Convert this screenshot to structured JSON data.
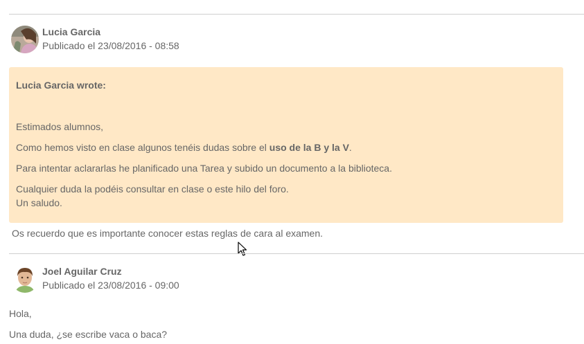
{
  "post1": {
    "author": "Lucia Garcia",
    "date": "Publicado el 23/08/2016 - 08:58",
    "quote": {
      "title": "Lucia Garcia wrote:",
      "greeting": "Estimados alumnos,",
      "line1_pre": "Como hemos visto en clase algunos tenéis dudas sobre el ",
      "line1_bold": "uso de la B y la V",
      "line1_post": ".",
      "line2": "Para intentar aclararlas he planificado una Tarea y subido un documento a la biblioteca.",
      "line3": "Cualquier duda la podéis consultar en clase o este hilo del foro.",
      "line4": "Un saludo."
    },
    "body": "Os recuerdo que es importante conocer estas reglas de cara al examen."
  },
  "post2": {
    "author": "Joel Aguilar Cruz",
    "date": "Publicado el 23/08/2016 - 09:00",
    "line1": "Hola,",
    "line2": "Una duda, ¿se escribe vaca o baca?"
  }
}
